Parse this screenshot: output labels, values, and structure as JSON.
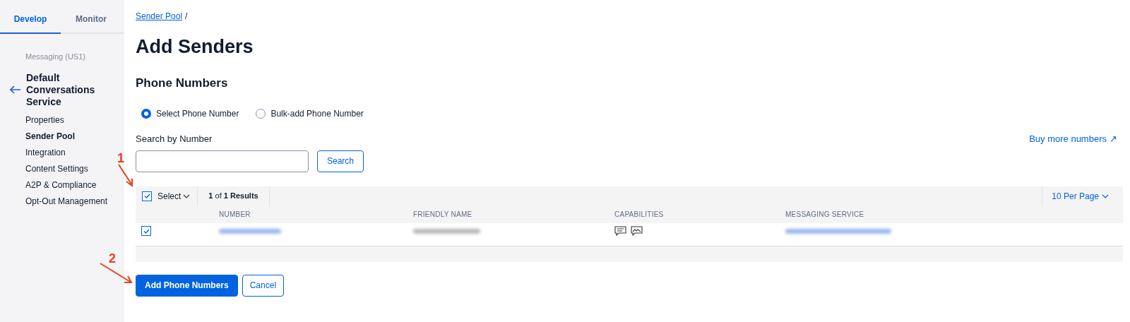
{
  "sidebar": {
    "tabs": [
      {
        "label": "Develop",
        "selected": true
      },
      {
        "label": "Monitor",
        "selected": false
      }
    ],
    "section": "Messaging (US1)",
    "service": "Default Conversations Service",
    "items": [
      {
        "label": "Properties",
        "selected": false
      },
      {
        "label": "Sender Pool",
        "selected": true
      },
      {
        "label": "Integration",
        "selected": false
      },
      {
        "label": "Content Settings",
        "selected": false
      },
      {
        "label": "A2P & Compliance",
        "selected": false
      },
      {
        "label": "Opt-Out Management",
        "selected": false
      }
    ]
  },
  "breadcrumb": {
    "link": "Sender Pool",
    "separator": "/"
  },
  "title": "Add Senders",
  "section_title": "Phone Numbers",
  "radios": [
    {
      "label": "Select Phone Number",
      "selected": true
    },
    {
      "label": "Bulk-add Phone Number",
      "selected": false
    }
  ],
  "search": {
    "label": "Search by Number",
    "button": "Search"
  },
  "buy_link": {
    "label": "Buy more numbers",
    "icon": "↗"
  },
  "table": {
    "select_all": {
      "checked": true,
      "label": "Select"
    },
    "results": "**1** of **1 Results**",
    "per_page": "10 Per Page",
    "columns": [
      "NUMBER",
      "FRIENDLY NAME",
      "CAPABILITIES",
      "MESSAGING SERVICE"
    ],
    "rows": [
      {
        "checked": true
      }
    ]
  },
  "buttons": [
    {
      "label": "Add Phone Numbers",
      "kind": "primary"
    },
    {
      "label": "Cancel",
      "kind": "secondary"
    }
  ],
  "annotations": [
    {
      "label": "1"
    },
    {
      "label": "2"
    }
  ]
}
